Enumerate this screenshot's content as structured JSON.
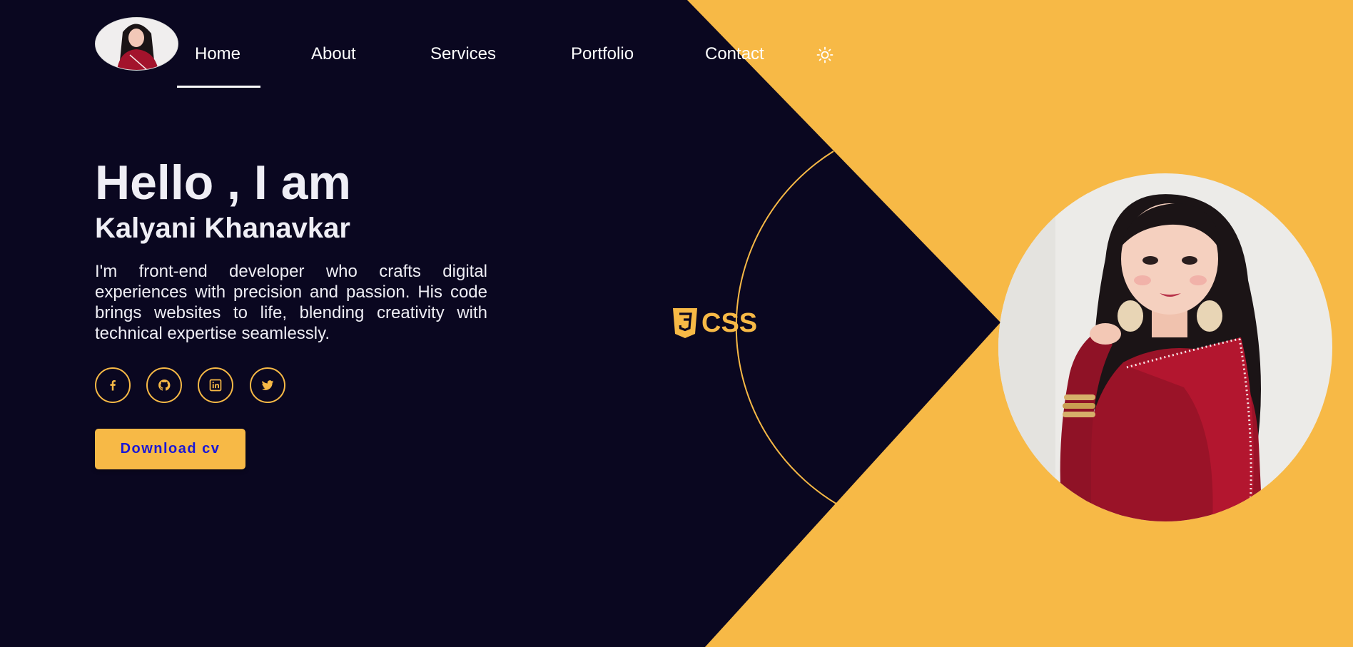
{
  "colors": {
    "background": "#0a0720",
    "accent": "#f7b946",
    "text": "#ffffff",
    "button_text": "#1a18d6"
  },
  "nav": {
    "logo_icon": "avatar-logo",
    "links": [
      {
        "label": "Home",
        "active": true
      },
      {
        "label": "About",
        "active": false
      },
      {
        "label": "Services",
        "active": false
      },
      {
        "label": "Portfolio",
        "active": false
      },
      {
        "label": "Contact",
        "active": false
      }
    ],
    "theme_icon": "sun-icon"
  },
  "hero": {
    "greeting": "Hello , I am",
    "name": "Kalyani Khanavkar",
    "bio": "I'm front-end developer who crafts digital experiences with precision and passion. His code brings websites to life, blending creativity with technical expertise seamlessly.",
    "socials": [
      {
        "icon": "facebook-icon"
      },
      {
        "icon": "github-icon"
      },
      {
        "icon": "linkedin-icon"
      },
      {
        "icon": "twitter-icon"
      }
    ],
    "cv_button": "Download cv"
  },
  "skill_badge": {
    "icon": "css3-icon",
    "label": "CSS"
  },
  "portrait": {
    "icon": "portrait-illustration"
  }
}
